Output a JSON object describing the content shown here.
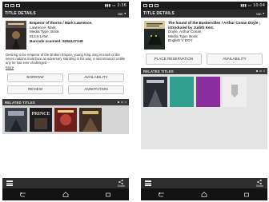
{
  "left": {
    "status_time": "2:36",
    "title": "TITLE DETAILS",
    "account": "Ian",
    "record": {
      "title": "Emperor of thorns / Mark Lawrence.",
      "author": "Lawrence, Mark.",
      "media_type": "Media Type: Book",
      "call_number": "813.6 LAW",
      "barcode": "Barcode scanned: 9284137248"
    },
    "description": "Desiring to be emperor of the Broken Empire, young King Jorg Ancrath of the seven nations must face an adversary standing in his way, a necromancer unlike any he has ever challenged --",
    "more": "More",
    "buttons": [
      "BORROW",
      "AVAILABILITY",
      "REVIEW",
      "ANNOTATION"
    ],
    "related_label": "RELATED TITLES",
    "related_covers": [
      {
        "bg": "#3b3f48",
        "fg": "#9aa3b4",
        "text": ""
      },
      {
        "bg": "#1c1c20",
        "fg": "#e8e0c8",
        "text": "PRINCE"
      },
      {
        "bg": "#6d1f1a",
        "fg": "#f1d48a",
        "text": ""
      },
      {
        "bg": "#3c2e22",
        "fg": "#d9b674",
        "text": ""
      }
    ],
    "share_label": "Share"
  },
  "right": {
    "status_time": "10:04",
    "title": "TITLE DETAILS",
    "account": "Ian",
    "record": {
      "title": "The hound of the Baskervilles / Arthur Conan Doyle ; introduced by Judith Kerr.",
      "author": "Doyle, Arthur Conan,",
      "media_type": "Media Type: Book",
      "call_number": "English V DOY"
    },
    "buttons": [
      "PLACE RESERVATION",
      "AVAILABILITY"
    ],
    "related_label": "RELATED TITLES",
    "related_covers": [
      {
        "bg": "#2a2b33",
        "fg": "#b8c0cf"
      },
      {
        "bg": "#2fa08e",
        "fg": "#2fa08e"
      },
      {
        "bg": "#8a2e9e",
        "fg": "#8a2e9e"
      },
      {
        "bg": "#ededed",
        "fg": "#b9b9b9"
      }
    ],
    "share_label": "Share"
  }
}
